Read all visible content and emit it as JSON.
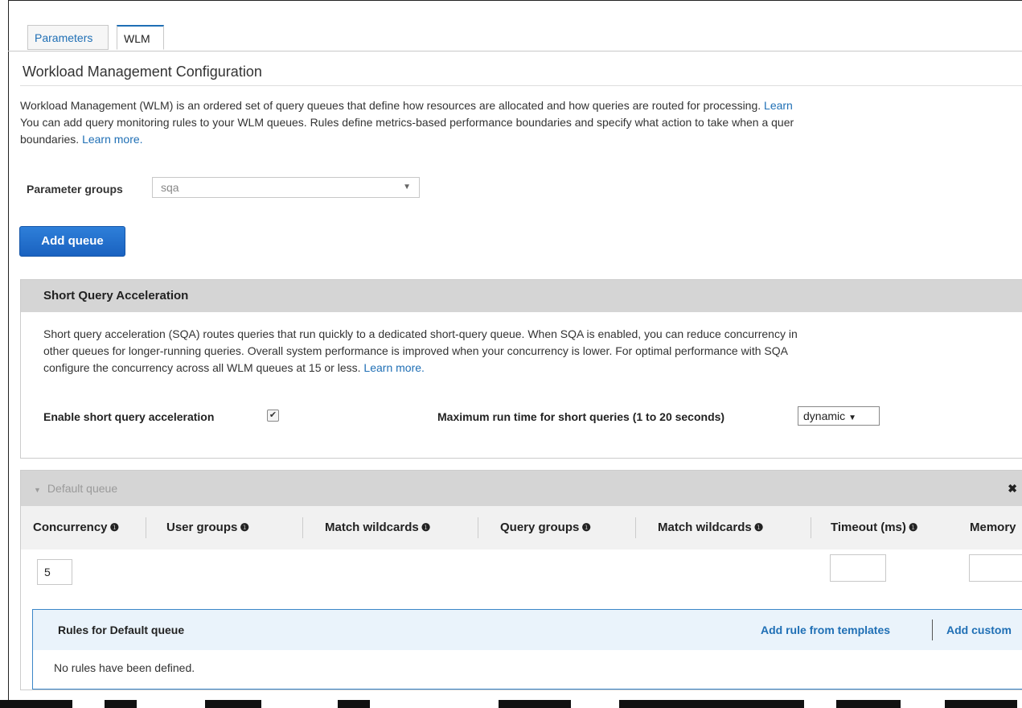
{
  "tabs": [
    {
      "label": "Parameters"
    },
    {
      "label": "WLM"
    }
  ],
  "page_title": "Workload Management Configuration",
  "description": {
    "line1": "Workload Management (WLM) is an ordered set of query queues that define how resources are allocated and how queries are routed for processing.",
    "line1_link": "Learn",
    "line2": "You can add query monitoring rules to your WLM queues. Rules define metrics-based performance boundaries and specify what action to take when a quer",
    "line3": "boundaries.",
    "line3_link": "Learn more."
  },
  "parameter_groups": {
    "label": "Parameter groups",
    "value": "sqa"
  },
  "add_queue_label": "Add queue",
  "sqa": {
    "title": "Short Query Acceleration",
    "line1": "Short query acceleration (SQA) routes queries that run quickly to a dedicated short-query queue. When SQA is enabled, you can reduce concurrency in",
    "line2": "other queues for longer-running queries. Overall system performance is improved when your concurrency is lower. For optimal performance with SQA",
    "line3": "configure the concurrency across all WLM queues at 15 or less.",
    "line3_link": "Learn more.",
    "enable_label": "Enable short query acceleration",
    "enable_checked": true,
    "max_runtime_label": "Maximum run time for short queries (1 to 20 seconds)",
    "max_runtime_value": "dynamic"
  },
  "default_queue": {
    "title": "Default queue",
    "columns": [
      {
        "label": "Concurrency"
      },
      {
        "label": "User groups"
      },
      {
        "label": "Match wildcards"
      },
      {
        "label": "Query groups"
      },
      {
        "label": "Match wildcards"
      },
      {
        "label": "Timeout (ms)"
      },
      {
        "label": "Memory"
      }
    ],
    "concurrency_value": "5",
    "rules": {
      "title": "Rules for Default queue",
      "add_from_templates": "Add rule from templates",
      "add_custom": "Add custom",
      "empty_text": "No rules have been defined."
    }
  },
  "icons": {
    "info": "info-circle-icon",
    "close": "close-icon",
    "collapse": "caret-down-icon",
    "select_caret": "chevron-down-icon",
    "checkbox": "checkbox-checked-icon"
  }
}
